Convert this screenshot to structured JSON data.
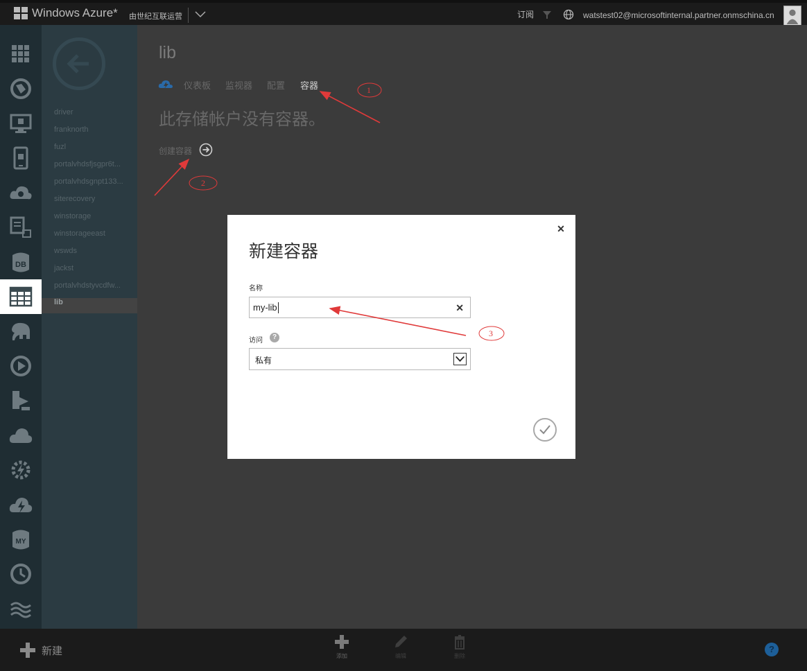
{
  "topbar": {
    "app_title": "Windows Azure*",
    "operator": "由世纪互联运营",
    "subscriptions": "订阅",
    "user_email": "watstest02@microsoftinternal.partner.onmschina.cn"
  },
  "nav_icons": [
    "grid-icon",
    "globe-icon",
    "monitor-icon",
    "mobile-icon",
    "cloud-gear-icon",
    "document-export-icon",
    "database-icon",
    "table-icon",
    "elephant-icon",
    "media-play-icon",
    "import-export-icon",
    "cloud-icon",
    "gear-bolt-icon",
    "cloud-bolt-icon",
    "mysql-icon",
    "clock-icon",
    "settings-icon"
  ],
  "item_list": {
    "items": [
      "driver",
      "franknorth",
      "fuzl",
      "portalvhdsfjsgpr6t...",
      "portalvhdsgnpt133...",
      "siterecovery",
      "winstorage",
      "winstorageeast",
      "wswds",
      "jackst",
      "portalvhdstyvcdfw...",
      "lib"
    ],
    "selected": "lib"
  },
  "main": {
    "title": "lib",
    "tabs": [
      "仪表板",
      "监视器",
      "配置",
      "容器"
    ],
    "active_tab": "容器",
    "empty_message": "此存储帐户没有容器。",
    "create_link": "创建容器"
  },
  "dialog": {
    "title": "新建容器",
    "name_label": "名称",
    "name_value": "my-lib",
    "access_label": "访问",
    "access_value": "私有"
  },
  "command_bar": {
    "new_label": "新建",
    "add_label": "添加",
    "edit_label": "编辑",
    "delete_label": "删除"
  },
  "annotations": [
    "1",
    "2",
    "3"
  ],
  "colors": {
    "annotation": "#e03a3a",
    "rail_bg": "#1f2d33",
    "list_bg": "#2b3b42",
    "content_bg": "#3b3b3b",
    "help_blue": "#1d5f99"
  }
}
